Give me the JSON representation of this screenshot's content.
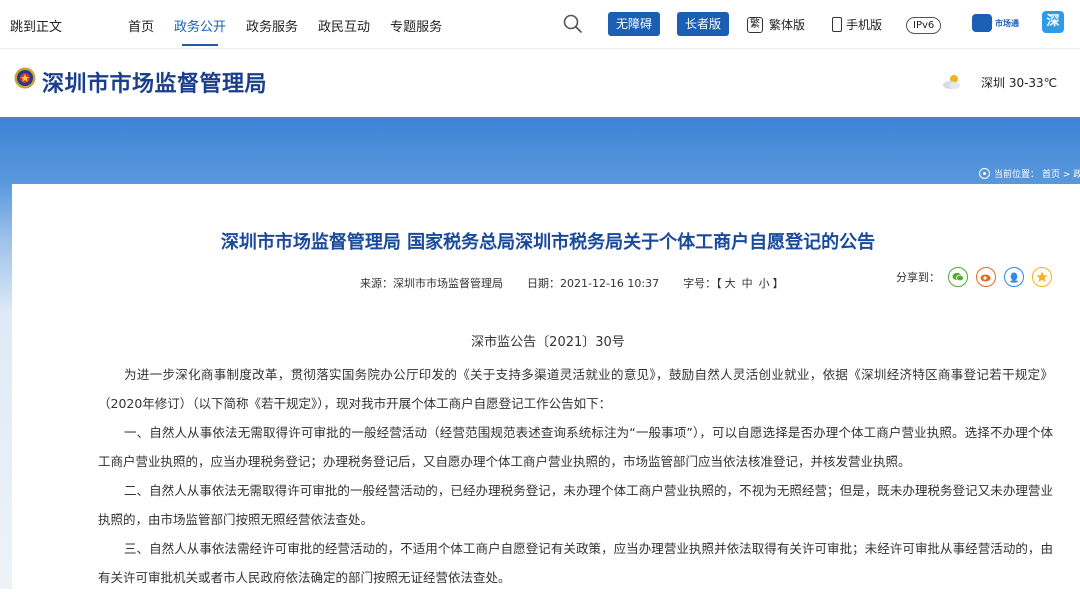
{
  "topbar": {
    "skip_label": "跳到正文",
    "nav": [
      "首页",
      "政务公开",
      "政务服务",
      "政民互动",
      "专题服务"
    ],
    "accessible_label": "无障碍",
    "elder_label": "长者版",
    "traditional_glyph": "繁",
    "traditional_label": "繁体版",
    "mobile_label": "手机版",
    "ipv6_label": "IPv6",
    "app1_label": "市场通",
    "app2_glyph": "深"
  },
  "header": {
    "site_title": "深圳市市场监督管理局",
    "weather": "深圳 30-33℃"
  },
  "breadcrumb": {
    "label": "当前位置：",
    "trail": "首页 > 政"
  },
  "article": {
    "title": "深圳市市场监督管理局 国家税务总局深圳市税务局关于个体工商户自愿登记的公告",
    "source": "来源：深圳市市场监督管理局",
    "date": "日期：2021-12-16 10:37",
    "font_size_label": "字号：【",
    "font_sizes": [
      "大",
      "中",
      "小"
    ],
    "font_size_close": "】",
    "share_label": "分享到：",
    "doc_no": "深市监公告〔2021〕30号",
    "paragraphs": [
      "为进一步深化商事制度改革，贯彻落实国务院办公厅印发的《关于支持多渠道灵活就业的意见》，鼓励自然人灵活创业就业，依据《深圳经济特区商事登记若干规定》（2020年修订）（以下简称《若干规定》），现对我市开展个体工商户自愿登记工作公告如下：",
      "一、自然人从事依法无需取得许可审批的一般经营活动（经营范围规范表述查询系统标注为“一般事项”），可以自愿选择是否办理个体工商户营业执照。选择不办理个体工商户营业执照的，应当办理税务登记；办理税务登记后，又自愿办理个体工商户营业执照的，市场监管部门应当依法核准登记，并核发营业执照。",
      "二、自然人从事依法无需取得许可审批的一般经营活动的，已经办理税务登记，未办理个体工商户营业执照的，不视为无照经营；但是，既未办理税务登记又未办理营业执照的，由市场监管部门按照无照经营依法查处。",
      "三、自然人从事依法需经许可审批的经营活动的，不适用个体工商户自愿登记有关政策，应当办理营业执照并依法取得有关许可审批；未经许可审批从事经营活动的，由有关许可审批机关或者市人民政府依法确定的部门按照无证经营依法查处。"
    ]
  },
  "icons": {
    "search": "search-icon",
    "emblem": "police-emblem-icon",
    "weather": "sun-cloud-icon",
    "pin": "location-pin-icon",
    "wechat": "wechat-icon",
    "weibo": "weibo-icon",
    "qq": "qq-icon",
    "qzone": "qzone-icon"
  },
  "colors": {
    "primary": "#1a5fb4",
    "title": "#1b3f8c",
    "article_title": "#1a4a9c"
  }
}
